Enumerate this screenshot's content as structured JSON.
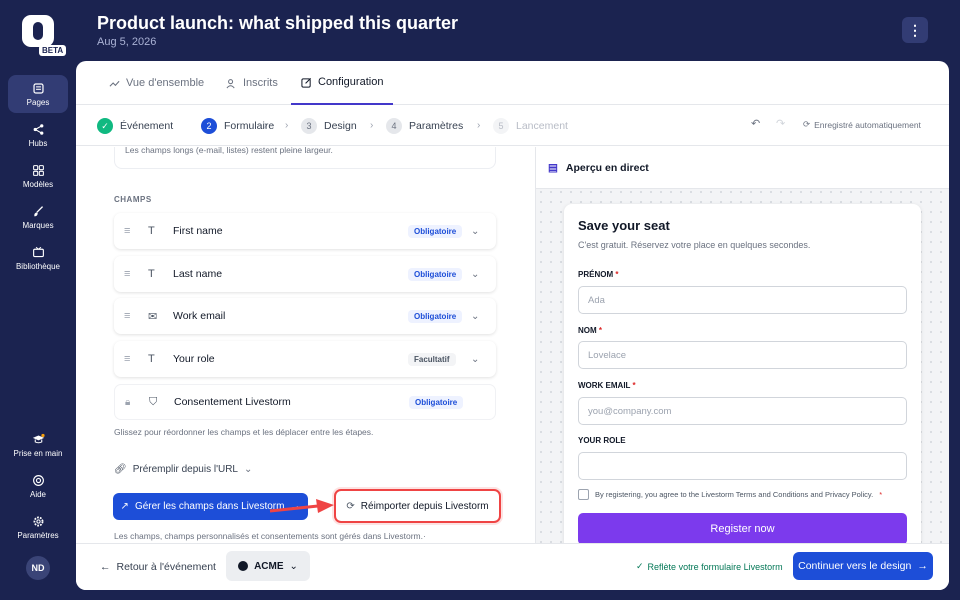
{
  "sidebar": {
    "beta": "BETA",
    "items": [
      {
        "label": "Pages",
        "icon": "pages-icon"
      },
      {
        "label": "Hubs",
        "icon": "share-icon"
      },
      {
        "label": "Modèles",
        "icon": "grid-icon"
      },
      {
        "label": "Marques",
        "icon": "brush-icon"
      },
      {
        "label": "Bibliothèque",
        "icon": "tv-icon"
      },
      {
        "label": "Prise en main",
        "icon": "graduation-icon"
      },
      {
        "label": "Aide",
        "icon": "help-icon"
      },
      {
        "label": "Paramètres",
        "icon": "gear-icon"
      }
    ],
    "avatar": "ND"
  },
  "header": {
    "title": "Product launch: what shipped this quarter",
    "date": "Aug 5, 2026",
    "more": "⋮"
  },
  "tabs": [
    {
      "label": "Vue d'ensemble"
    },
    {
      "label": "Inscrits"
    },
    {
      "label": "Configuration"
    }
  ],
  "steps": [
    {
      "num": "✓",
      "label": "Événement"
    },
    {
      "num": "2",
      "label": "Formulaire"
    },
    {
      "num": "3",
      "label": "Design"
    },
    {
      "num": "4",
      "label": "Paramètres"
    },
    {
      "num": "5",
      "label": "Lancement"
    }
  ],
  "autosave": "Enregistré automatiquement",
  "left": {
    "note": "Les champs longs (e-mail, listes) restent pleine largeur.",
    "section_label": "CHAMPS",
    "fields": [
      {
        "name": "First name",
        "badge": "Obligatoire"
      },
      {
        "name": "Last name",
        "badge": "Obligatoire"
      },
      {
        "name": "Work email",
        "badge": "Obligatoire"
      },
      {
        "name": "Your role",
        "badge": "Facultatif"
      },
      {
        "name": "Consentement Livestorm",
        "badge": "Obligatoire"
      }
    ],
    "reorder_hint": "Glissez pour réordonner les champs et les déplacer entre les étapes.",
    "prefill": "Préremplir depuis l'URL",
    "manage_button": "Gérer les champs dans Livestorm",
    "reimport_button": "Réimporter depuis Livestorm",
    "managed_note": "Les champs, champs personnalisés et consentements sont gérés dans Livestorm.·"
  },
  "preview": {
    "title": "Aperçu en direct",
    "form_title": "Save your seat",
    "form_subtitle": "C'est gratuit. Réservez votre place en quelques secondes.",
    "fields": [
      {
        "label": "PRÉNOM",
        "required": "*",
        "placeholder": "Ada"
      },
      {
        "label": "NOM",
        "required": "*",
        "placeholder": "Lovelace"
      },
      {
        "label": "WORK EMAIL",
        "required": "*",
        "placeholder": "you@company.com"
      },
      {
        "label": "YOUR ROLE",
        "required": "",
        "placeholder": ""
      }
    ],
    "consent": "By registering, you agree to the Livestorm Terms and Conditions and Privacy Policy.",
    "consent_star": "*",
    "register": "Register now"
  },
  "footer": {
    "back": "Retour à l'événement",
    "brand": "ACME",
    "reflect": "Reflète votre formulaire Livestorm",
    "continue": "Continuer vers le design"
  },
  "colors": {
    "sidebar_bg": "#1b2350",
    "primary": "#1d4ed8",
    "register": "#7c3aed",
    "highlight": "#ef4444"
  }
}
